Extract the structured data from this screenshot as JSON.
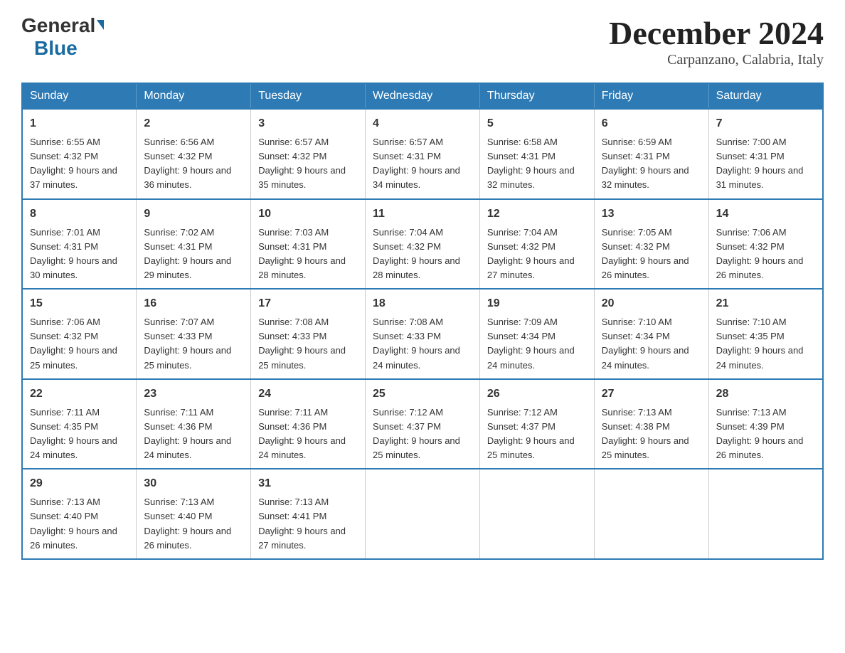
{
  "header": {
    "logo_general": "General",
    "logo_blue": "Blue",
    "month_title": "December 2024",
    "location": "Carpanzano, Calabria, Italy"
  },
  "weekdays": [
    "Sunday",
    "Monday",
    "Tuesday",
    "Wednesday",
    "Thursday",
    "Friday",
    "Saturday"
  ],
  "weeks": [
    [
      {
        "day": "1",
        "sunrise": "6:55 AM",
        "sunset": "4:32 PM",
        "daylight": "9 hours and 37 minutes."
      },
      {
        "day": "2",
        "sunrise": "6:56 AM",
        "sunset": "4:32 PM",
        "daylight": "9 hours and 36 minutes."
      },
      {
        "day": "3",
        "sunrise": "6:57 AM",
        "sunset": "4:32 PM",
        "daylight": "9 hours and 35 minutes."
      },
      {
        "day": "4",
        "sunrise": "6:57 AM",
        "sunset": "4:31 PM",
        "daylight": "9 hours and 34 minutes."
      },
      {
        "day": "5",
        "sunrise": "6:58 AM",
        "sunset": "4:31 PM",
        "daylight": "9 hours and 32 minutes."
      },
      {
        "day": "6",
        "sunrise": "6:59 AM",
        "sunset": "4:31 PM",
        "daylight": "9 hours and 32 minutes."
      },
      {
        "day": "7",
        "sunrise": "7:00 AM",
        "sunset": "4:31 PM",
        "daylight": "9 hours and 31 minutes."
      }
    ],
    [
      {
        "day": "8",
        "sunrise": "7:01 AM",
        "sunset": "4:31 PM",
        "daylight": "9 hours and 30 minutes."
      },
      {
        "day": "9",
        "sunrise": "7:02 AM",
        "sunset": "4:31 PM",
        "daylight": "9 hours and 29 minutes."
      },
      {
        "day": "10",
        "sunrise": "7:03 AM",
        "sunset": "4:31 PM",
        "daylight": "9 hours and 28 minutes."
      },
      {
        "day": "11",
        "sunrise": "7:04 AM",
        "sunset": "4:32 PM",
        "daylight": "9 hours and 28 minutes."
      },
      {
        "day": "12",
        "sunrise": "7:04 AM",
        "sunset": "4:32 PM",
        "daylight": "9 hours and 27 minutes."
      },
      {
        "day": "13",
        "sunrise": "7:05 AM",
        "sunset": "4:32 PM",
        "daylight": "9 hours and 26 minutes."
      },
      {
        "day": "14",
        "sunrise": "7:06 AM",
        "sunset": "4:32 PM",
        "daylight": "9 hours and 26 minutes."
      }
    ],
    [
      {
        "day": "15",
        "sunrise": "7:06 AM",
        "sunset": "4:32 PM",
        "daylight": "9 hours and 25 minutes."
      },
      {
        "day": "16",
        "sunrise": "7:07 AM",
        "sunset": "4:33 PM",
        "daylight": "9 hours and 25 minutes."
      },
      {
        "day": "17",
        "sunrise": "7:08 AM",
        "sunset": "4:33 PM",
        "daylight": "9 hours and 25 minutes."
      },
      {
        "day": "18",
        "sunrise": "7:08 AM",
        "sunset": "4:33 PM",
        "daylight": "9 hours and 24 minutes."
      },
      {
        "day": "19",
        "sunrise": "7:09 AM",
        "sunset": "4:34 PM",
        "daylight": "9 hours and 24 minutes."
      },
      {
        "day": "20",
        "sunrise": "7:10 AM",
        "sunset": "4:34 PM",
        "daylight": "9 hours and 24 minutes."
      },
      {
        "day": "21",
        "sunrise": "7:10 AM",
        "sunset": "4:35 PM",
        "daylight": "9 hours and 24 minutes."
      }
    ],
    [
      {
        "day": "22",
        "sunrise": "7:11 AM",
        "sunset": "4:35 PM",
        "daylight": "9 hours and 24 minutes."
      },
      {
        "day": "23",
        "sunrise": "7:11 AM",
        "sunset": "4:36 PM",
        "daylight": "9 hours and 24 minutes."
      },
      {
        "day": "24",
        "sunrise": "7:11 AM",
        "sunset": "4:36 PM",
        "daylight": "9 hours and 24 minutes."
      },
      {
        "day": "25",
        "sunrise": "7:12 AM",
        "sunset": "4:37 PM",
        "daylight": "9 hours and 25 minutes."
      },
      {
        "day": "26",
        "sunrise": "7:12 AM",
        "sunset": "4:37 PM",
        "daylight": "9 hours and 25 minutes."
      },
      {
        "day": "27",
        "sunrise": "7:13 AM",
        "sunset": "4:38 PM",
        "daylight": "9 hours and 25 minutes."
      },
      {
        "day": "28",
        "sunrise": "7:13 AM",
        "sunset": "4:39 PM",
        "daylight": "9 hours and 26 minutes."
      }
    ],
    [
      {
        "day": "29",
        "sunrise": "7:13 AM",
        "sunset": "4:40 PM",
        "daylight": "9 hours and 26 minutes."
      },
      {
        "day": "30",
        "sunrise": "7:13 AM",
        "sunset": "4:40 PM",
        "daylight": "9 hours and 26 minutes."
      },
      {
        "day": "31",
        "sunrise": "7:13 AM",
        "sunset": "4:41 PM",
        "daylight": "9 hours and 27 minutes."
      },
      null,
      null,
      null,
      null
    ]
  ],
  "labels": {
    "sunrise": "Sunrise:",
    "sunset": "Sunset:",
    "daylight": "Daylight:"
  }
}
